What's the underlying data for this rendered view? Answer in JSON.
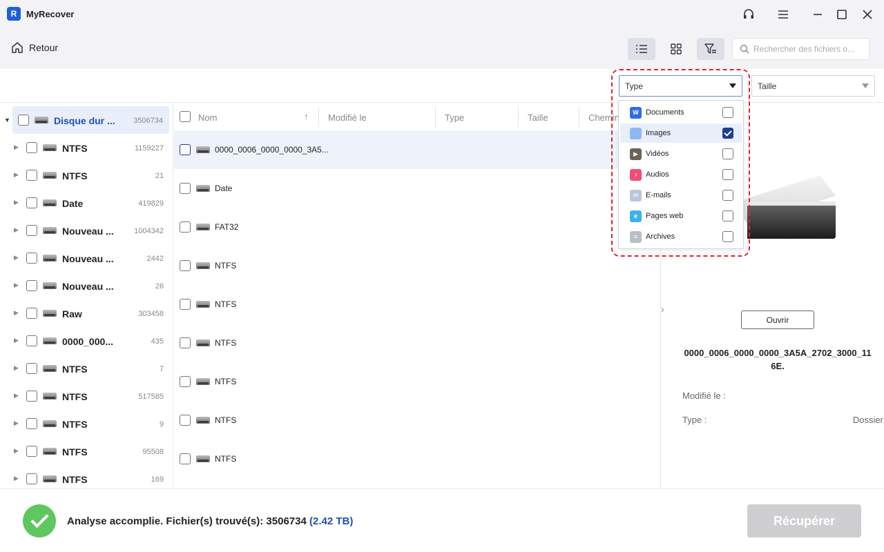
{
  "app": {
    "title": "MyRecover",
    "logo_letter": "R"
  },
  "toolbar": {
    "back_label": "Retour",
    "search_placeholder": "Rechercher des fichiers o..."
  },
  "filters": {
    "type_label": "Type",
    "size_label": "Taille"
  },
  "type_options": [
    {
      "label": "Documents",
      "icon_letter": "W",
      "icon_color": "#2f6de1",
      "checked": false
    },
    {
      "label": "Images",
      "icon_letter": "",
      "icon_color": "#8fb8f0",
      "checked": true
    },
    {
      "label": "Vidéos",
      "icon_letter": "▶",
      "icon_color": "#6d6256",
      "checked": false
    },
    {
      "label": "Audios",
      "icon_letter": "♪",
      "icon_color": "#ef4f74",
      "checked": false
    },
    {
      "label": "E-mails",
      "icon_letter": "✉",
      "icon_color": "#b9c7d8",
      "checked": false
    },
    {
      "label": "Pages web",
      "icon_letter": "e",
      "icon_color": "#3db2e8",
      "checked": false
    },
    {
      "label": "Archives",
      "icon_letter": "≡",
      "icon_color": "#b9bec7",
      "checked": false
    }
  ],
  "tree": {
    "root": {
      "label": "Disque dur ...",
      "count": "3506734"
    },
    "items": [
      {
        "label": "NTFS",
        "count": "1159227"
      },
      {
        "label": "NTFS",
        "count": "21"
      },
      {
        "label": "Date",
        "count": "419829"
      },
      {
        "label": "Nouveau ...",
        "count": "1004342"
      },
      {
        "label": "Nouveau ...",
        "count": "2442"
      },
      {
        "label": "Nouveau ...",
        "count": "26"
      },
      {
        "label": "Raw",
        "count": "303458"
      },
      {
        "label": "0000_000...",
        "count": "435"
      },
      {
        "label": "NTFS",
        "count": "7"
      },
      {
        "label": "NTFS",
        "count": "517585"
      },
      {
        "label": "NTFS",
        "count": "9"
      },
      {
        "label": "NTFS",
        "count": "95508"
      },
      {
        "label": "NTFS",
        "count": "169"
      }
    ]
  },
  "list": {
    "columns": {
      "name": "Nom",
      "modified": "Modifié le",
      "type": "Type",
      "size": "Taille",
      "path": "Chemin"
    },
    "rows": [
      {
        "name": "0000_0006_0000_0000_3A5..."
      },
      {
        "name": "Date"
      },
      {
        "name": "FAT32"
      },
      {
        "name": "NTFS"
      },
      {
        "name": "NTFS"
      },
      {
        "name": "NTFS"
      },
      {
        "name": "NTFS"
      },
      {
        "name": "NTFS"
      },
      {
        "name": "NTFS"
      }
    ]
  },
  "details": {
    "open_label": "Ouvrir",
    "file_name": "0000_0006_0000_0000_3A5A_2702_3000_116E.",
    "modified_label": "Modifié le :",
    "type_label": "Type :",
    "type_value": "Dossier"
  },
  "status": {
    "text": "Analyse accomplie. Fichier(s) trouvé(s): 3506734",
    "size": "(2.42 TB)",
    "recover_label": "Récupérer"
  }
}
